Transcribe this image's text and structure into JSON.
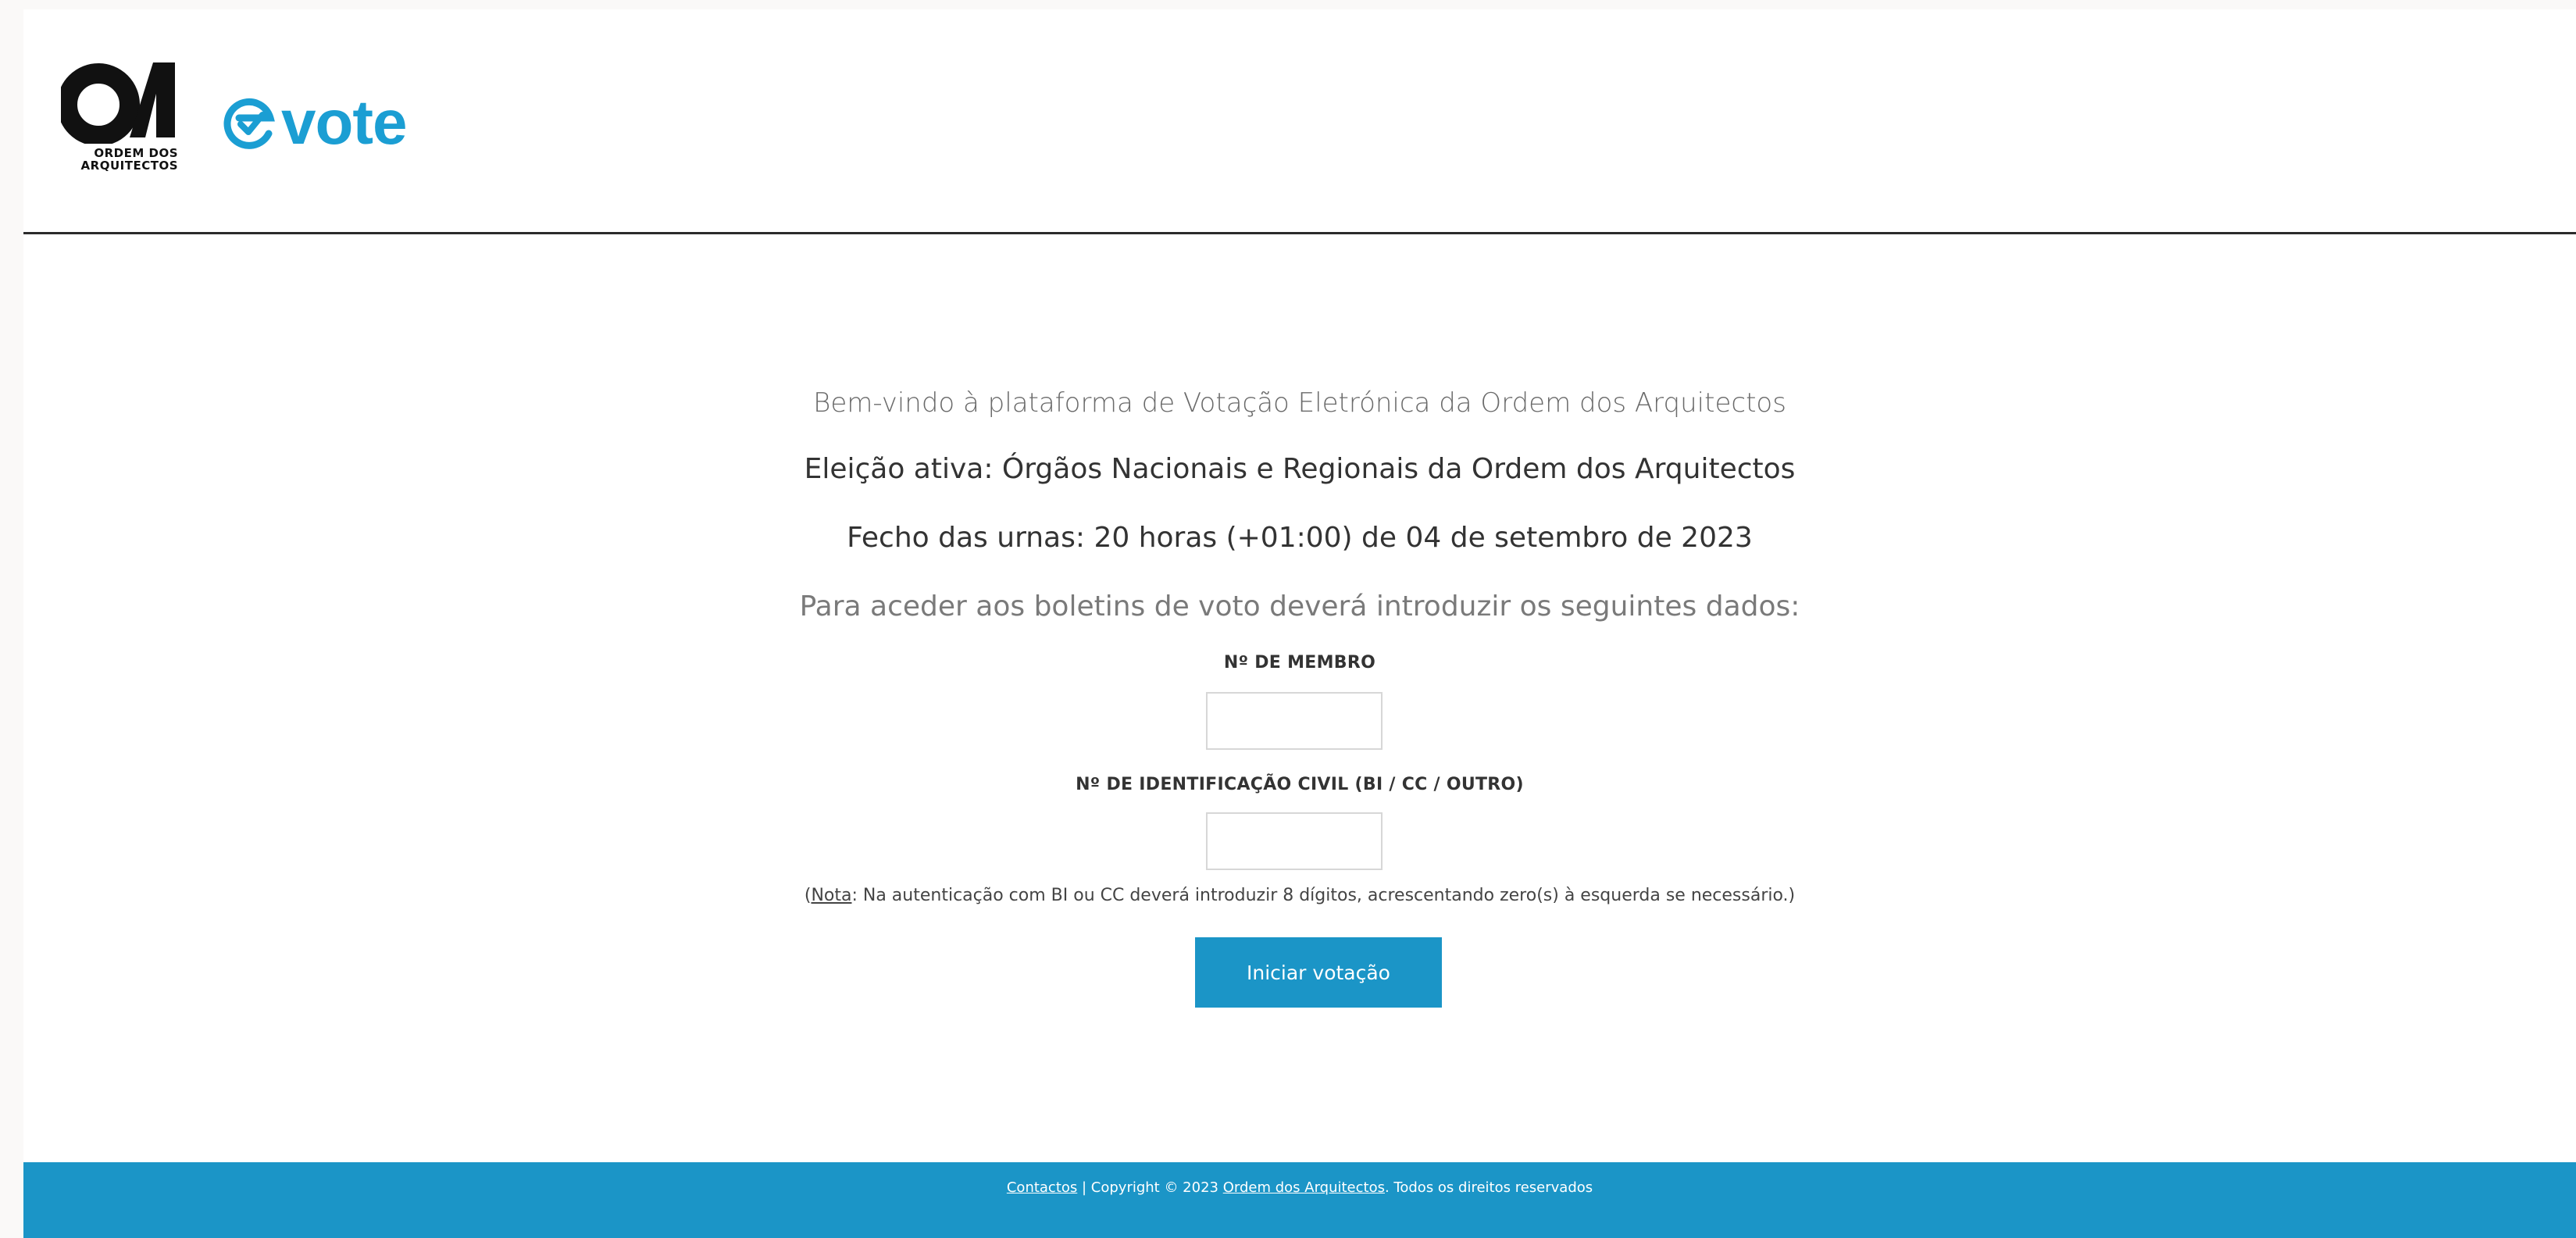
{
  "brand": {
    "org_name_line1": "ORDEM DOS",
    "org_name_line2": "ARQUITECTOS",
    "product_name": "vote",
    "accent_color": "#1b95c7"
  },
  "main": {
    "welcome_text": "Bem-vindo à plataforma de Votação Eletrónica da Ordem dos Arquitectos",
    "election_text": "Eleição ativa: Órgãos Nacionais e Regionais da Ordem dos Arquitectos",
    "deadline_text": "Fecho das urnas: 20 horas (+01:00) de 04 de setembro de 2023",
    "instruction_text": "Para aceder aos boletins de voto deverá introduzir os seguintes dados:",
    "member_label": "Nº DE MEMBRO",
    "member_value": "",
    "id_label": "Nº DE IDENTIFICAÇÃO CIVIL (BI / CC / OUTRO)",
    "id_value": "",
    "note_open": "(",
    "note_label": "Nota",
    "note_text": ": Na autenticação com BI ou CC deverá introduzir 8 dígitos, acrescentando zero(s) à esquerda se necessário.)",
    "start_button": "Iniciar votação"
  },
  "footer": {
    "contacts_link": "Contactos",
    "copyright_text": " | Copyright © 2023 ",
    "org_link": "Ordem dos Arquitectos",
    "rights_text": ". Todos os direitos reservados"
  }
}
